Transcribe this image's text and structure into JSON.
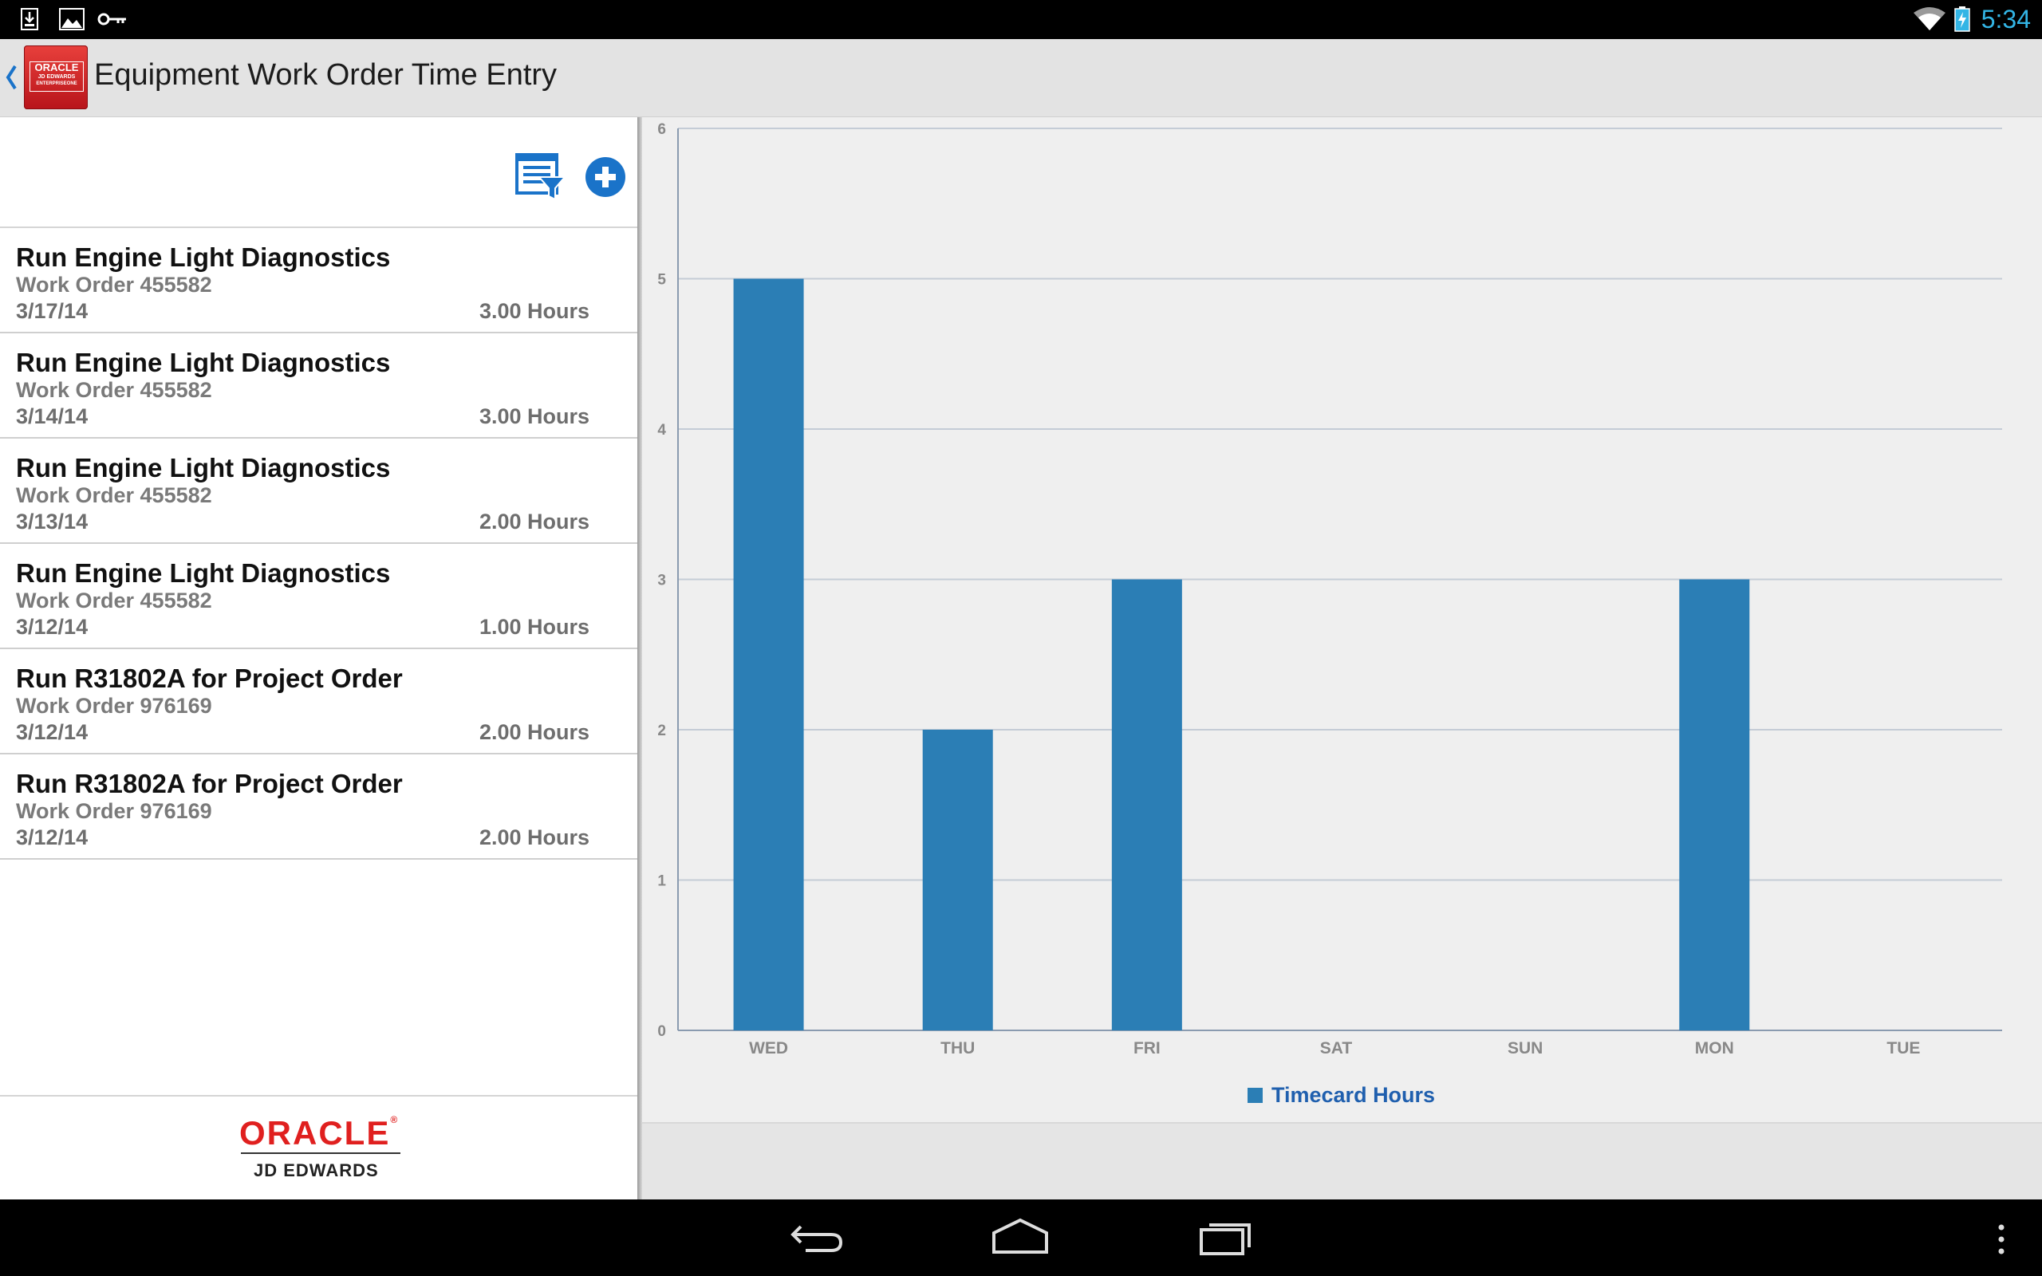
{
  "status_bar": {
    "clock": "5:34",
    "left_icons": [
      "download-icon",
      "image-icon",
      "key-icon"
    ],
    "right_icons": [
      "wifi-icon",
      "battery-charging-icon"
    ]
  },
  "action_bar": {
    "title": "Equipment Work Order Time Entry",
    "back_icon": "chevron-left-icon",
    "logo_text": "ORACLE JD EDWARDS ENTERPRISEONE"
  },
  "toolbar": {
    "filter_icon": "filter-list-icon",
    "add_icon": "add-circle-icon"
  },
  "entries": [
    {
      "title": "Run Engine Light Diagnostics",
      "work_order": "Work Order 455582",
      "date": "3/17/14",
      "hours": "3.00 Hours"
    },
    {
      "title": "Run Engine Light Diagnostics",
      "work_order": "Work Order 455582",
      "date": "3/14/14",
      "hours": "3.00 Hours"
    },
    {
      "title": "Run Engine Light Diagnostics",
      "work_order": "Work Order 455582",
      "date": "3/13/14",
      "hours": "2.00 Hours"
    },
    {
      "title": "Run Engine Light Diagnostics",
      "work_order": "Work Order 455582",
      "date": "3/12/14",
      "hours": "1.00 Hours"
    },
    {
      "title": "Run R31802A for Project Order",
      "work_order": "Work Order 976169",
      "date": "3/12/14",
      "hours": "2.00 Hours"
    },
    {
      "title": "Run R31802A for Project Order",
      "work_order": "Work Order 976169",
      "date": "3/12/14",
      "hours": "2.00 Hours"
    }
  ],
  "footer": {
    "brand": "ORACLE",
    "sub_brand": "JD EDWARDS"
  },
  "chart_data": {
    "type": "bar",
    "categories": [
      "WED",
      "THU",
      "FRI",
      "SAT",
      "SUN",
      "MON",
      "TUE"
    ],
    "series": [
      {
        "name": "Timecard Hours",
        "values": [
          5,
          2,
          3,
          0,
          0,
          3,
          0
        ]
      }
    ],
    "ylim": [
      0,
      6
    ],
    "yticks": [
      "0",
      "1",
      "2",
      "3",
      "4",
      "5",
      "6"
    ],
    "grid": true,
    "legend": "bottom-center",
    "bar_color": "#2b7eb5",
    "legend_text_color": "#1f5fae"
  },
  "nav_bar": {
    "icons": [
      "back-icon",
      "home-icon",
      "recent-apps-icon",
      "menu-overflow-icon"
    ]
  }
}
